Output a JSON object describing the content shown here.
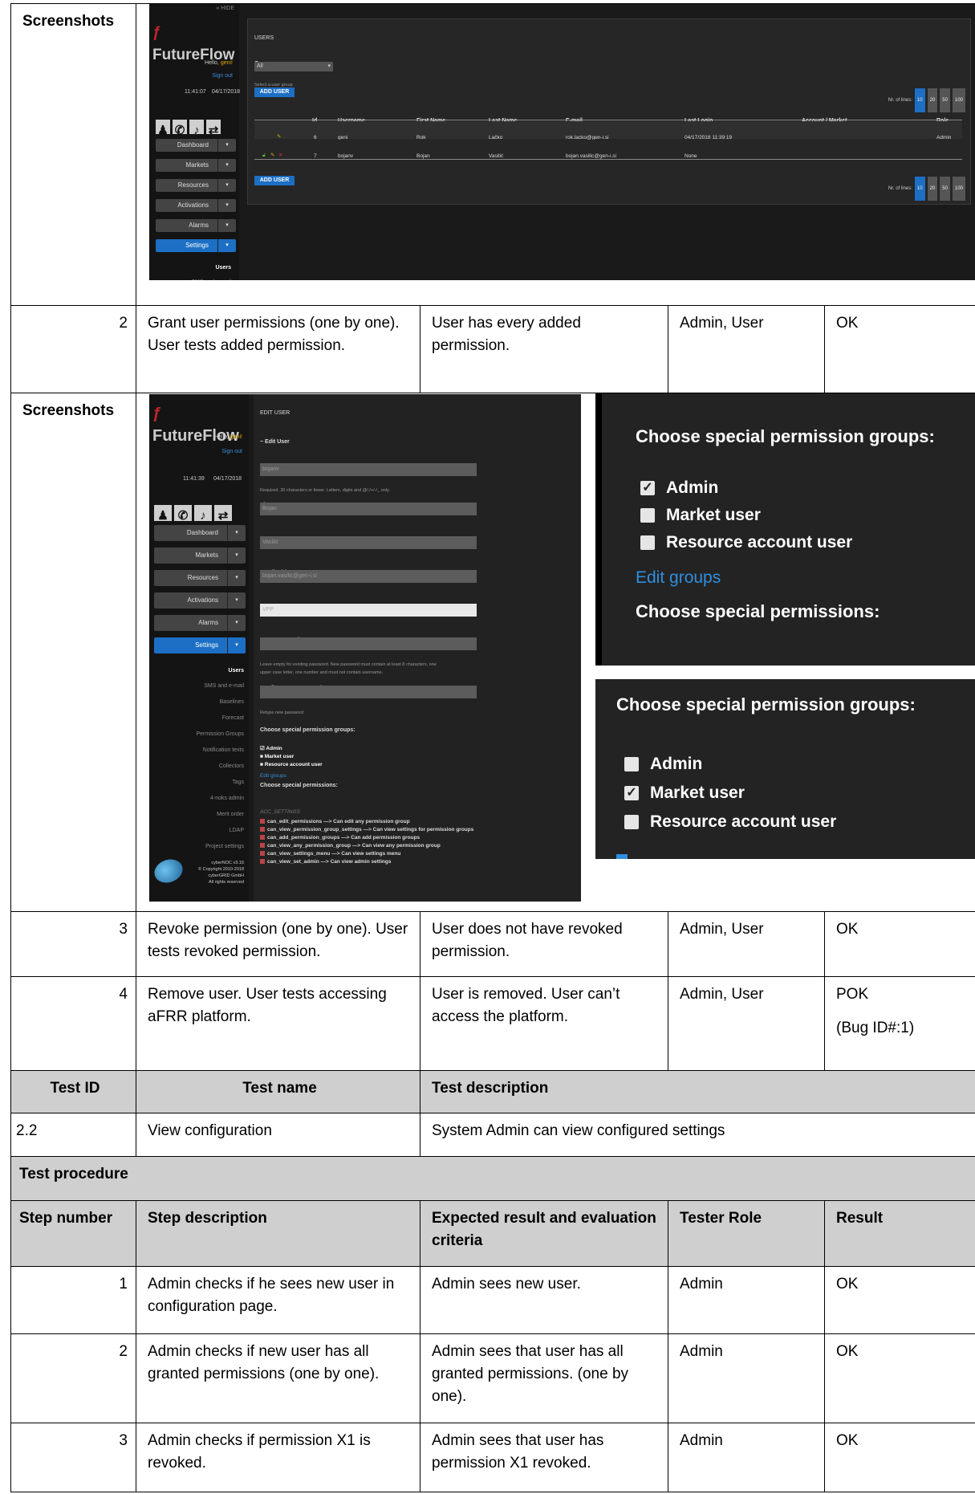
{
  "labels": {
    "screenshots": "Screenshots"
  },
  "app1": {
    "top_tag": "« HIDE",
    "logo": "FutureFlow",
    "hello_prefix": "Hello, ",
    "hello_user": "geni!",
    "sign_out": "Sign out",
    "time": "11:41:07",
    "date": "04/17/2018",
    "nav": [
      "Dashboard",
      "Markets",
      "Resources",
      "Activations",
      "Alarms",
      "Settings"
    ],
    "subnav": [
      "Users",
      "SMS and e-mail"
    ],
    "panel_title": "USERS",
    "group_label": "Group",
    "group_value": "All",
    "group_hint": "Select a user group",
    "add_user": "ADD USER",
    "nr_lines": "Nr. of lines:",
    "line_options": [
      "10",
      "20",
      "50",
      "100"
    ],
    "columns": [
      "Id",
      "Username",
      "First Name",
      "Last Name",
      "E-mail",
      "Last Login",
      "Account / Market",
      "Role"
    ],
    "rows": [
      [
        "6",
        "geni",
        "Rok",
        "Lačko",
        "rok.lacko@gen-i.si",
        "04/17/2018 11:39:19",
        "",
        "Admin"
      ],
      [
        "7",
        "bojanv",
        "Bojan",
        "Vasilić",
        "bojan.vasilic@gen-i.si",
        "None",
        "",
        ""
      ]
    ]
  },
  "app2": {
    "logo": "FutureFlow",
    "hello_prefix": "Hello, ",
    "hello_user": "geni!",
    "sign_out": "Sign out",
    "time": "11:41:39",
    "date": "04/17/2018",
    "nav": [
      "Dashboard",
      "Markets",
      "Resources",
      "Activations",
      "Alarms",
      "Settings"
    ],
    "subnav": [
      "Users",
      "SMS and e-mail",
      "Baselines",
      "Forecast",
      "Permission Groups",
      "Notification texts",
      "Collectors",
      "Tags",
      "4-noks admin",
      "Merit order",
      "LDAP",
      "Project settings"
    ],
    "footer": [
      "cyberNOC v3.16",
      "© Copyright 2010-2018",
      "cyberGRID GmbH",
      "All rights reserved"
    ],
    "panel_title": "EDIT USER",
    "section": "− Edit User",
    "username_label": "Username:",
    "username_value": "bojanv",
    "username_hint": "Required. 30 characters or fewer. Letters, digits and @/./+/-/_ only.",
    "first_label": "First name:",
    "first_value": "Bojan",
    "last_label": "Last name:",
    "last_value": "Vasilić",
    "email_label": "Email address:",
    "email_value": "bojan.vasilic@gen-i.si",
    "owner_label": "Owner:",
    "owner_value": "VPP",
    "newpw_label": "New password:",
    "newpw_hint1": "Leave empty for existing password. New password must contain at least 8 characters, one",
    "newpw_hint2": "upper case letter, one number and must not contain username.",
    "confirm_label": "Confirm new password:",
    "confirm_hint": "Retype new password",
    "groups_title": "Choose special permission groups:",
    "groups": [
      "Admin",
      "Market user",
      "Resource account user"
    ],
    "edit_groups": "Edit groups",
    "perms_title": "Choose special permissions:",
    "acc_settings": "ACC_SETTINGS",
    "perms": [
      "can_edit_permissions —> Can edit any permission group",
      "can_view_permission_group_settings —> Can view settings for permission groups",
      "can_add_permission_groups —> Can add permission groups",
      "can_view_any_permission_group —> Can view any permission group",
      "can_view_settings_menu —> Can view settings menu",
      "can_view_set_admin —> Can view admin settings"
    ]
  },
  "zoom1": {
    "title": "Choose special permission groups:",
    "items": [
      "Admin",
      "Market user",
      "Resource account user"
    ],
    "checked": [
      true,
      false,
      false
    ],
    "edit_groups": "Edit groups",
    "perms_title": "Choose special permissions:"
  },
  "zoom2": {
    "title": "Choose special permission groups:",
    "items": [
      "Admin",
      "Market user",
      "Resource account user"
    ],
    "checked": [
      false,
      true,
      false
    ]
  },
  "steps_a": [
    {
      "num": "2",
      "desc": "Grant user permissions (one by one). User tests added permission.",
      "expected": "User has every added permission.",
      "role": "Admin, User",
      "result": "OK",
      "result2": ""
    },
    {
      "num": "3",
      "desc": "Revoke permission (one by one). User tests revoked permission.",
      "expected": "User does not have revoked permission.",
      "role": "Admin, User",
      "result": "OK",
      "result2": ""
    },
    {
      "num": "4",
      "desc": "Remove user. User tests accessing aFRR platform.",
      "expected": "User is removed. User can’t access the platform.",
      "role": "Admin, User",
      "result": "POK",
      "result2": "(Bug ID#:1)"
    }
  ],
  "test_header": {
    "id": "Test ID",
    "name": "Test name",
    "desc": "Test description"
  },
  "test": {
    "id": "2.2",
    "name": "View configuration",
    "desc": "System Admin can view configured settings"
  },
  "procedure": "Test procedure",
  "step_header": {
    "num": "Step number",
    "desc": "Step description",
    "expected": "Expected result and evaluation criteria",
    "role": "Tester Role",
    "result": "Result"
  },
  "steps_b": [
    {
      "num": "1",
      "desc": "Admin checks if he sees new user in configuration page.",
      "expected": "Admin sees new user.",
      "role": "Admin",
      "result": "OK"
    },
    {
      "num": "2",
      "desc": "Admin checks if new user has all granted permissions (one by one).",
      "expected": "Admin sees that user has all granted permissions. (one by one).",
      "role": "Admin",
      "result": "OK"
    },
    {
      "num": "3",
      "desc": "Admin checks if permission X1 is revoked.",
      "expected": "Admin sees that user has permission X1 revoked.",
      "role": "Admin",
      "result": "OK"
    }
  ]
}
